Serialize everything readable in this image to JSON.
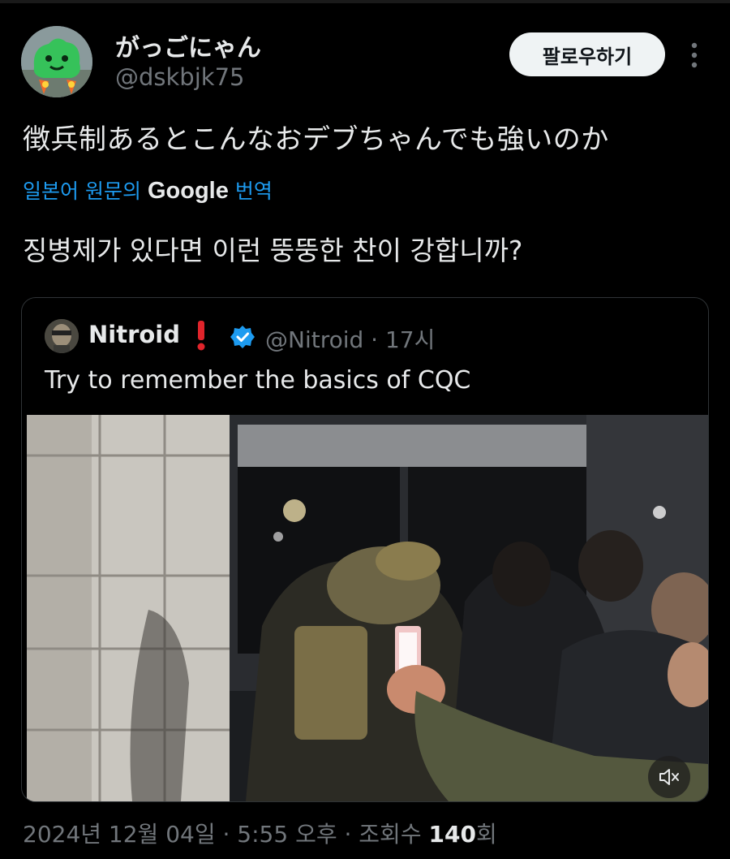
{
  "author": {
    "display_name": "がっごにゃん",
    "handle": "@dskbjk75",
    "avatar_icon": "green-creature-avatar"
  },
  "actions": {
    "follow_label": "팔로우하기",
    "more_icon": "more-vertical-icon"
  },
  "tweet": {
    "text": "徴兵制あるとこんなおデブちゃんでも強いのか",
    "translation": {
      "prefix": "일본어 원문의",
      "google": "Google",
      "suffix": "번역",
      "text": "징병제가 있다면 이런 뚱뚱한 찬이 강합니까?"
    }
  },
  "quoted": {
    "name": "Nitroid",
    "handle_time": "@Nitroid · 17시",
    "text": "Try to remember the basics of CQC",
    "badges": [
      "red-exclamation-icon",
      "verified-badge-icon"
    ],
    "media": {
      "mute_icon": "speaker-muted-icon"
    }
  },
  "meta": {
    "timestamp": "2024년 12월 04일 · 5:55 오후 · 조회수 ",
    "views": "140",
    "views_suffix": "회"
  },
  "colors": {
    "background": "#000000",
    "text": "#e7e9ea",
    "muted": "#71767b",
    "accent": "#1d9bf0"
  }
}
